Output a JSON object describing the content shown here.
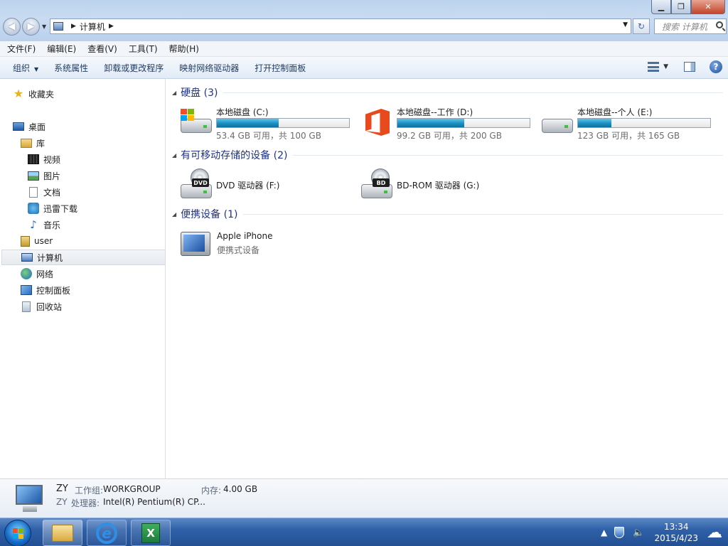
{
  "window": {
    "address_crumb": "计算机",
    "search_placeholder": "搜索 计算机",
    "min_glyph": "▁",
    "max_glyph": "❐",
    "close_glyph": "✕",
    "back_glyph": "◀",
    "forward_glyph": "▶"
  },
  "menu": [
    "文件(F)",
    "编辑(E)",
    "查看(V)",
    "工具(T)",
    "帮助(H)"
  ],
  "commands": {
    "organize": "组织",
    "system_properties": "系统属性",
    "uninstall": "卸载或更改程序",
    "map_drive": "映射网络驱动器",
    "control_panel": "打开控制面板",
    "help_glyph": "?"
  },
  "nav": {
    "favorites": "收藏夹",
    "desktop": "桌面",
    "libraries": "库",
    "videos": "视频",
    "pictures": "图片",
    "documents": "文档",
    "downloads": "迅雷下载",
    "music": "音乐",
    "user": "user",
    "computer": "计算机",
    "network": "网络",
    "control_panel": "控制面板",
    "recycle_bin": "回收站",
    "star_glyph": "★",
    "music_glyph": "♪"
  },
  "groups": {
    "hard_disks": "硬盘 (3)",
    "removable": "有可移动存储的设备 (2)",
    "portable": "便携设备 (1)"
  },
  "drives": [
    {
      "name": "本地磁盘 (C:)",
      "free": "53.4 GB 可用，共 100 GB",
      "used_fraction": 0.466
    },
    {
      "name": "本地磁盘--工作 (D:)",
      "free": "99.2 GB 可用，共 200 GB",
      "used_fraction": 0.504
    },
    {
      "name": "本地磁盘--个人 (E:)",
      "free": "123 GB 可用，共 165 GB",
      "used_fraction": 0.255
    }
  ],
  "removable": [
    {
      "name": "DVD 驱动器 (F:)",
      "badge": "DVD"
    },
    {
      "name": "BD-ROM 驱动器 (G:)",
      "badge": "BD"
    }
  ],
  "portable": {
    "name": "Apple iPhone",
    "type": "便携式设备"
  },
  "details": {
    "name": "ZY",
    "name2": "ZY",
    "workgroup_label": "工作组:",
    "workgroup": "WORKGROUP",
    "memory_label": "内存:",
    "memory": "4.00 GB",
    "cpu_label": "处理器:",
    "cpu": "Intel(R) Pentium(R) CP..."
  },
  "taskbar": {
    "time": "13:34",
    "date": "2015/4/23",
    "tray_up": "▲",
    "speaker_glyph": "🔈",
    "ie_glyph": "e",
    "excel_glyph": "X",
    "weather_glyph": "☁"
  },
  "colors": {
    "group_title": "#1e3287",
    "bar_fill": "#1a8fc2",
    "taskbar": "#2f61a9"
  }
}
